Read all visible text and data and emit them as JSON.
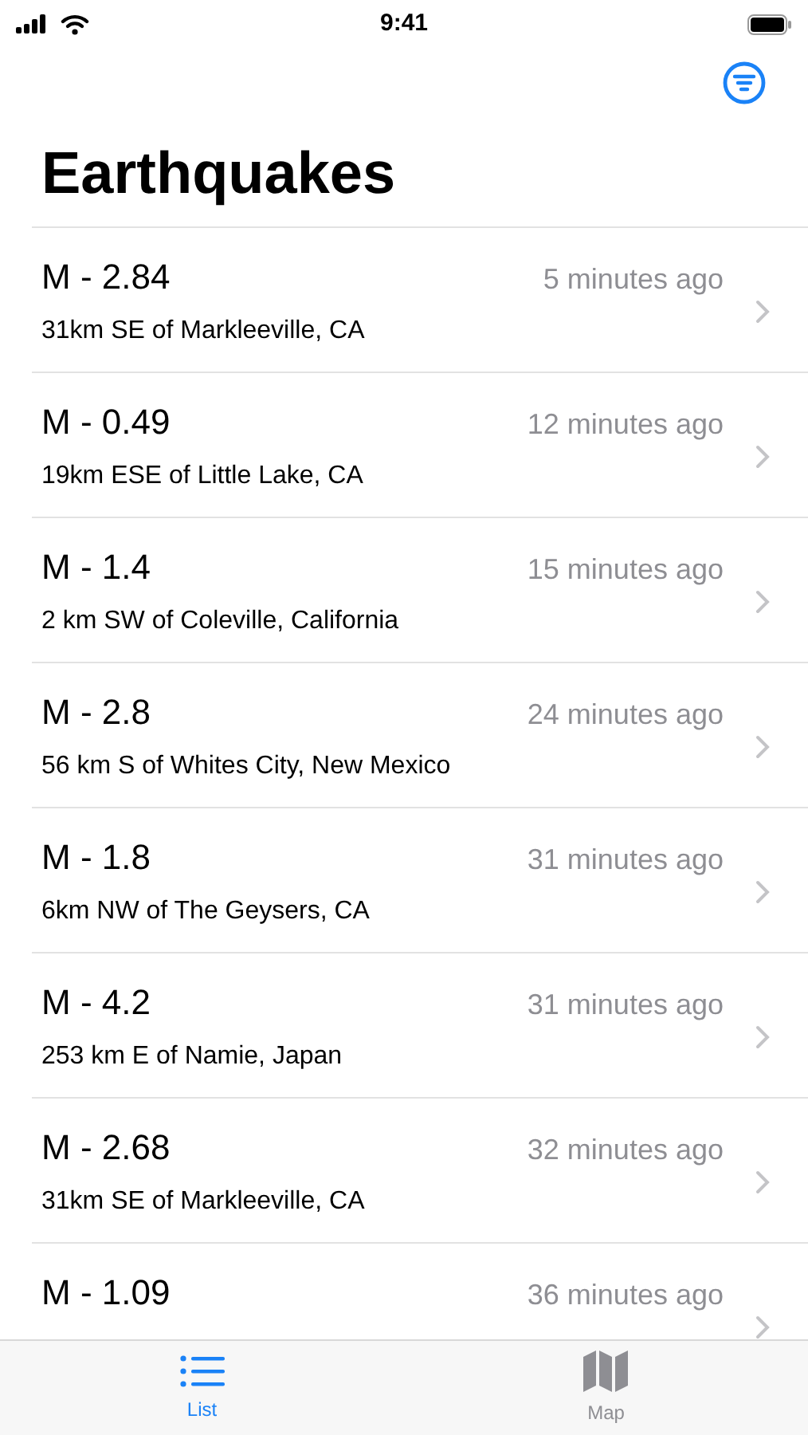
{
  "status_bar": {
    "time": "9:41"
  },
  "title": "Earthquakes",
  "quakes": [
    {
      "magnitude": "M - 2.84",
      "time": "5 minutes ago",
      "location": "31km SE of Markleeville, CA"
    },
    {
      "magnitude": "M - 0.49",
      "time": "12 minutes ago",
      "location": "19km ESE of Little Lake, CA"
    },
    {
      "magnitude": "M - 1.4",
      "time": "15 minutes ago",
      "location": "2 km SW of Coleville, California"
    },
    {
      "magnitude": "M - 2.8",
      "time": "24 minutes ago",
      "location": "56 km S of Whites City, New Mexico"
    },
    {
      "magnitude": "M - 1.8",
      "time": "31 minutes ago",
      "location": "6km NW of The Geysers, CA"
    },
    {
      "magnitude": "M - 4.2",
      "time": "31 minutes ago",
      "location": "253 km E of Namie, Japan"
    },
    {
      "magnitude": "M - 2.68",
      "time": "32 minutes ago",
      "location": "31km SE of Markleeville, CA"
    },
    {
      "magnitude": "M - 1.09",
      "time": "36 minutes ago"
    }
  ],
  "tabs": [
    {
      "label": "List",
      "kind": "list",
      "selected": true
    },
    {
      "label": "Map",
      "kind": "map",
      "selected": false
    }
  ]
}
